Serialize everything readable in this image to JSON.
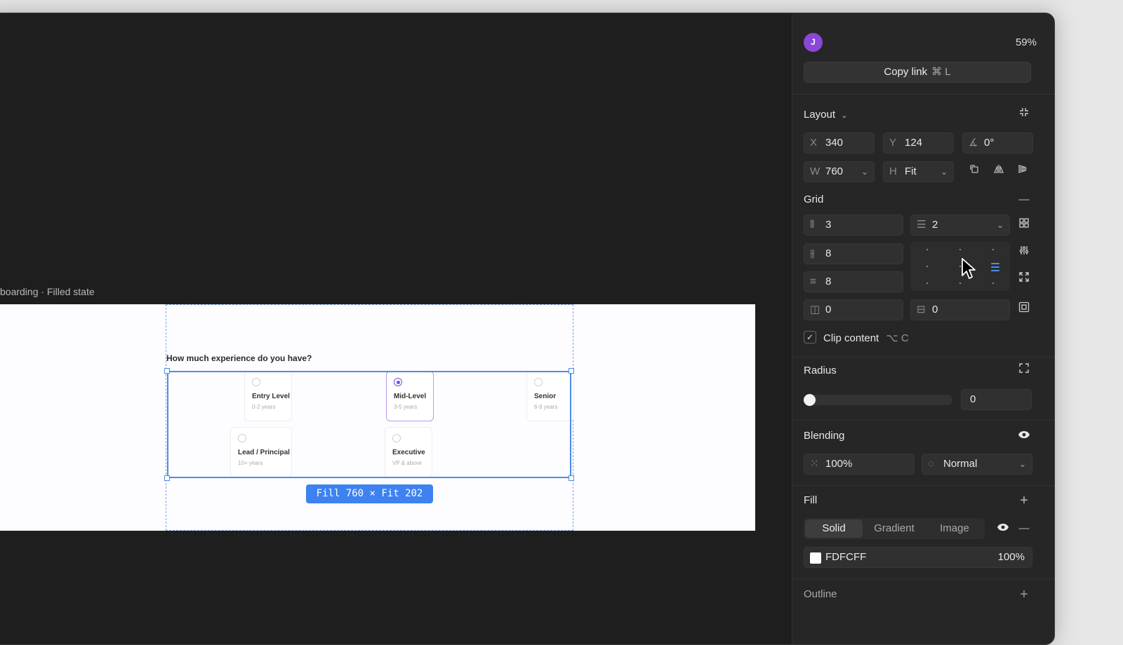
{
  "canvas": {
    "frame_label": "boarding · Filled state",
    "question": "How much experience do you have?",
    "cards": [
      {
        "title": "Entry Level",
        "subtitle": "0-2 years",
        "selected": false
      },
      {
        "title": "Mid-Level",
        "subtitle": "3-5 years",
        "selected": true
      },
      {
        "title": "Senior",
        "subtitle": "6-9 years",
        "selected": false
      },
      {
        "title": "Lead / Principal",
        "subtitle": "10+ years",
        "selected": false
      },
      {
        "title": "Executive",
        "subtitle": "VP & above",
        "selected": false
      }
    ],
    "size_badge": "Fill 760 × Fit 202"
  },
  "panel": {
    "avatar_initial": "J",
    "zoom": "59%",
    "copy_link": {
      "label": "Copy link",
      "shortcut": "⌘ L"
    },
    "layout": {
      "title": "Layout",
      "x": {
        "label": "X",
        "value": "340"
      },
      "y": {
        "label": "Y",
        "value": "124"
      },
      "rotation": {
        "label": "∡",
        "value": "0°"
      },
      "w": {
        "label": "W",
        "value": "760"
      },
      "h": {
        "label": "H",
        "value": "Fit"
      }
    },
    "grid": {
      "title": "Grid",
      "columns": "3",
      "rows": "2",
      "column_gap": "8",
      "row_gap": "8",
      "padding_horizontal": "0",
      "padding_vertical": "0",
      "clip_content": {
        "label": "Clip content",
        "shortcut": "⌥ C",
        "checked": true
      }
    },
    "radius": {
      "title": "Radius",
      "value": "0",
      "slider_fraction": 0
    },
    "blending": {
      "title": "Blending",
      "opacity": "100%",
      "mode": "Normal"
    },
    "fill": {
      "title": "Fill",
      "tabs": [
        "Solid",
        "Gradient",
        "Image"
      ],
      "active_tab": "Solid",
      "color_hex": "FDFCFF",
      "color_opacity": "100%",
      "swatch_color": "#FDFCFF"
    },
    "outline": {
      "title": "Outline"
    }
  },
  "colors": {
    "accent": "#4A8DE8",
    "avatar": "#8A47D8",
    "radio_selected": "#7A4FD6",
    "badge": "#3D82F0"
  }
}
